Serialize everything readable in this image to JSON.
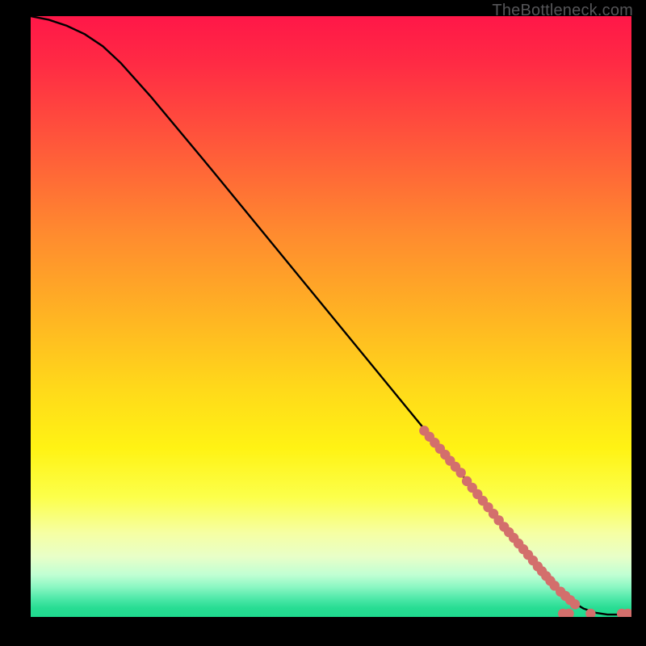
{
  "attribution": "TheBottleneck.com",
  "chart_data": {
    "type": "line",
    "title": "",
    "xlabel": "",
    "ylabel": "",
    "xlim": [
      0,
      100
    ],
    "ylim": [
      0,
      100
    ],
    "grid": false,
    "legend": false,
    "curve": [
      {
        "x": 0,
        "y": 100
      },
      {
        "x": 3,
        "y": 99.4
      },
      {
        "x": 6,
        "y": 98.4
      },
      {
        "x": 9,
        "y": 97.0
      },
      {
        "x": 12,
        "y": 95.0
      },
      {
        "x": 15,
        "y": 92.2
      },
      {
        "x": 20,
        "y": 86.6
      },
      {
        "x": 30,
        "y": 74.6
      },
      {
        "x": 40,
        "y": 62.4
      },
      {
        "x": 50,
        "y": 50.2
      },
      {
        "x": 60,
        "y": 38.0
      },
      {
        "x": 70,
        "y": 25.8
      },
      {
        "x": 78,
        "y": 16.1
      },
      {
        "x": 84,
        "y": 8.9
      },
      {
        "x": 88,
        "y": 4.4
      },
      {
        "x": 90,
        "y": 2.6
      },
      {
        "x": 92,
        "y": 1.4
      },
      {
        "x": 94,
        "y": 0.7
      },
      {
        "x": 96,
        "y": 0.4
      },
      {
        "x": 100,
        "y": 0.4
      }
    ],
    "marker_clusters": [
      {
        "x0": 65.5,
        "x1": 69.0,
        "y0": 31.0,
        "y1": 27.0,
        "n": 5
      },
      {
        "x0": 69.8,
        "x1": 71.6,
        "y0": 26.0,
        "y1": 24.0,
        "n": 3
      },
      {
        "x0": 72.6,
        "x1": 78.8,
        "y0": 22.6,
        "y1": 15.0,
        "n": 8
      },
      {
        "x0": 79.6,
        "x1": 83.6,
        "y0": 14.1,
        "y1": 9.4,
        "n": 6
      },
      {
        "x0": 84.4,
        "x1": 87.2,
        "y0": 8.4,
        "y1": 5.2,
        "n": 5
      },
      {
        "x0": 88.2,
        "x1": 90.6,
        "y0": 4.2,
        "y1": 2.1,
        "n": 4
      }
    ],
    "marker_points": [
      {
        "x": 88.6,
        "y": 0.55
      },
      {
        "x": 89.6,
        "y": 0.55
      },
      {
        "x": 93.2,
        "y": 0.55
      },
      {
        "x": 98.4,
        "y": 0.55
      },
      {
        "x": 99.4,
        "y": 0.55
      }
    ],
    "colors": {
      "curve": "#000000",
      "marker": "#d36f6c"
    }
  }
}
